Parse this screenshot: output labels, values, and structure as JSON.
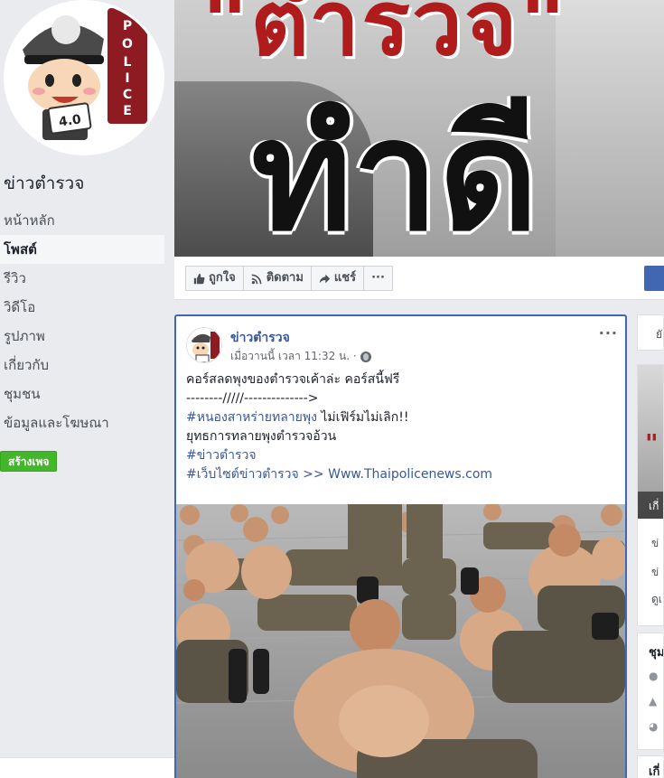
{
  "page": {
    "name": "ข่าวตำรวจ",
    "avatar_badge_text": "4.0",
    "avatar_banner_text": "POLICE"
  },
  "sidebar": {
    "items": [
      {
        "label": "หน้าหลัก",
        "active": false
      },
      {
        "label": "โพสต์",
        "active": true
      },
      {
        "label": "รีวิว",
        "active": false
      },
      {
        "label": "วิดีโอ",
        "active": false
      },
      {
        "label": "รูปภาพ",
        "active": false
      },
      {
        "label": "เกี่ยวกับ",
        "active": false
      },
      {
        "label": "ชุมชน",
        "active": false
      },
      {
        "label": "ข้อมูลและโฆษณา",
        "active": false
      }
    ],
    "create_page_label": "สร้างเพจ"
  },
  "cover": {
    "title": "\"ตำรวจ\"",
    "subtitle": "ทำดี"
  },
  "actions": {
    "like": "ถูกใจ",
    "follow": "ติดตาม",
    "share": "แชร์",
    "more": "···"
  },
  "post": {
    "author": "ข่าวตำรวจ",
    "time": "เมื่อวานนี้ เวลา 11:32 น. ·",
    "more": "···",
    "lines": [
      {
        "text": "คอร์สลดพุงของตำรวจเค้าล่ะ คอร์สนี้ฟรี",
        "tag": null
      },
      {
        "text": "--------/////-------------->",
        "tag": null
      },
      {
        "tag": "#หนองสาหร่ายทลายพุง",
        "text": " ไม่เฟิร์มไม่เลิก!!"
      },
      {
        "text": "ยุทธการทลายพุงตำรวจอ้วน",
        "tag": null
      },
      {
        "tag": "#ข่าวตำรวจ",
        "text": ""
      },
      {
        "tag": "#เว็บไซต์ข่าวตำรวจ",
        "text": " >> Www.Thaipolicenews.com"
      }
    ]
  },
  "right_column": {
    "r1_text": "ยั",
    "r2_caption": "เกี่",
    "r2_red_text": "\"",
    "r2_lines": [
      "ข่",
      "ข่",
      "ดูเ"
    ],
    "r3_heading": "ชุม",
    "r4_heading": "เกี่"
  },
  "colors": {
    "facebook_blue": "#4267b2",
    "link_blue": "#385898",
    "create_green": "#42b72a",
    "cover_red": "#b01c1c"
  }
}
